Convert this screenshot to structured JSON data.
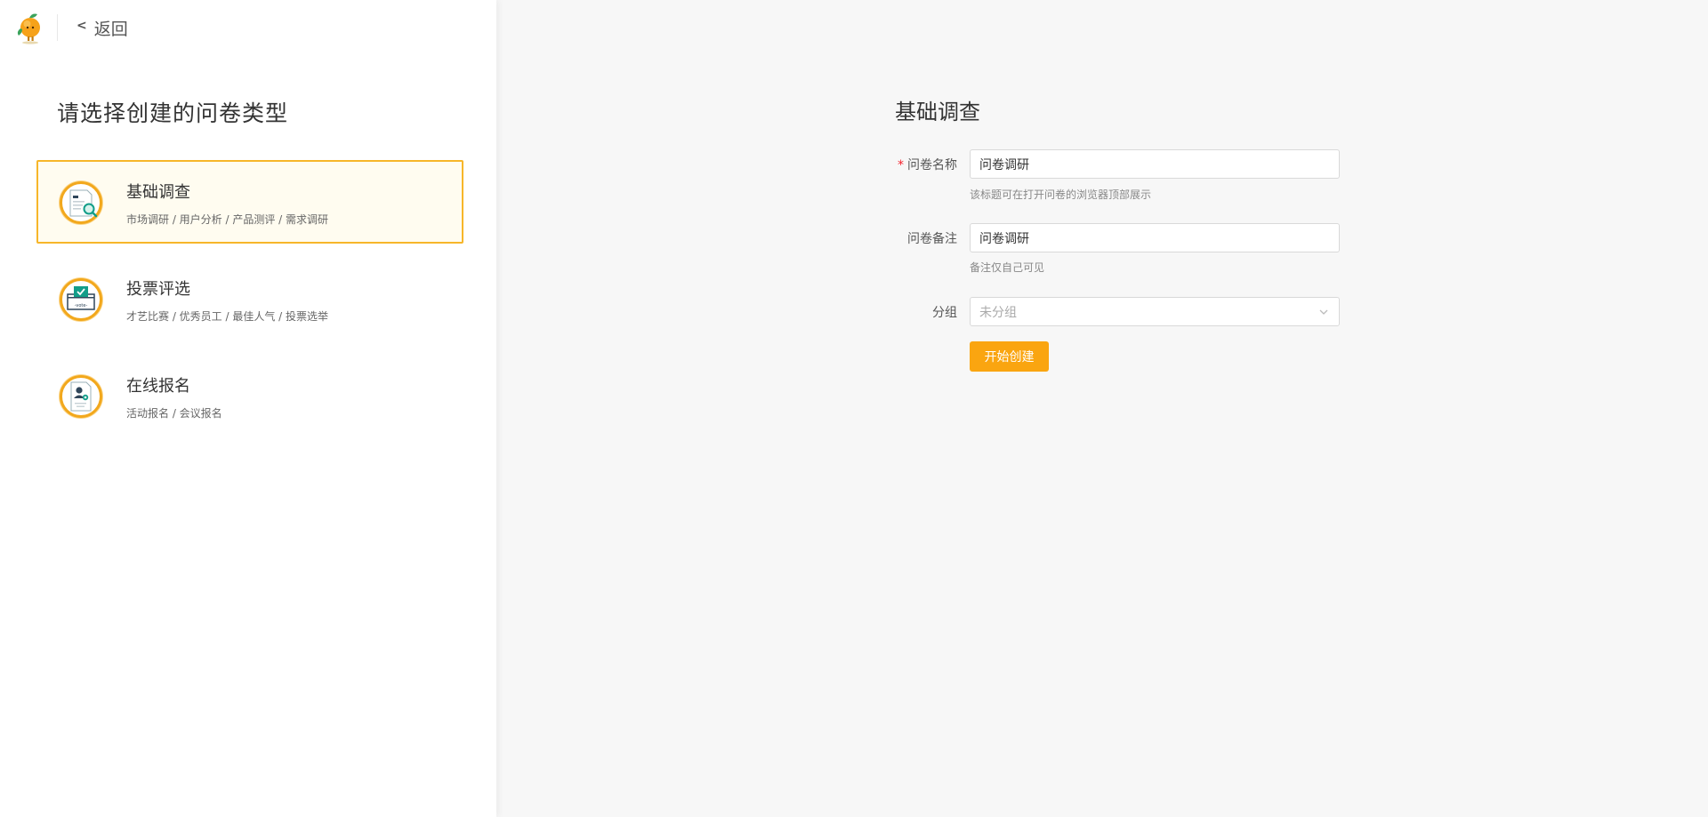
{
  "header": {
    "back_label": "返回",
    "back_chevron": "<"
  },
  "left_panel": {
    "title": "请选择创建的问卷类型",
    "types": [
      {
        "title": "基础调查",
        "desc": "市场调研 / 用户分析 / 产品测评 / 需求调研",
        "icon": "survey-document-icon",
        "selected": true
      },
      {
        "title": "投票评选",
        "desc": "才艺比赛 / 优秀员工 / 最佳人气 / 投票选举",
        "icon": "vote-box-icon",
        "selected": false
      },
      {
        "title": "在线报名",
        "desc": "活动报名 / 会议报名",
        "icon": "registration-form-icon",
        "selected": false
      }
    ]
  },
  "form": {
    "title": "基础调查",
    "name": {
      "required_mark": "*",
      "label": "问卷名称",
      "value": "问卷调研",
      "hint": "该标题可在打开问卷的浏览器顶部展示"
    },
    "remark": {
      "label": "问卷备注",
      "value": "问卷调研",
      "hint": "备注仅自己可见"
    },
    "group": {
      "label": "分组",
      "placeholder": "未分组"
    },
    "submit_label": "开始创建"
  },
  "colors": {
    "accent": "#faa510",
    "selected_border": "#f7b62a",
    "selected_bg": "#fffcf0",
    "required": "#f5222d"
  }
}
